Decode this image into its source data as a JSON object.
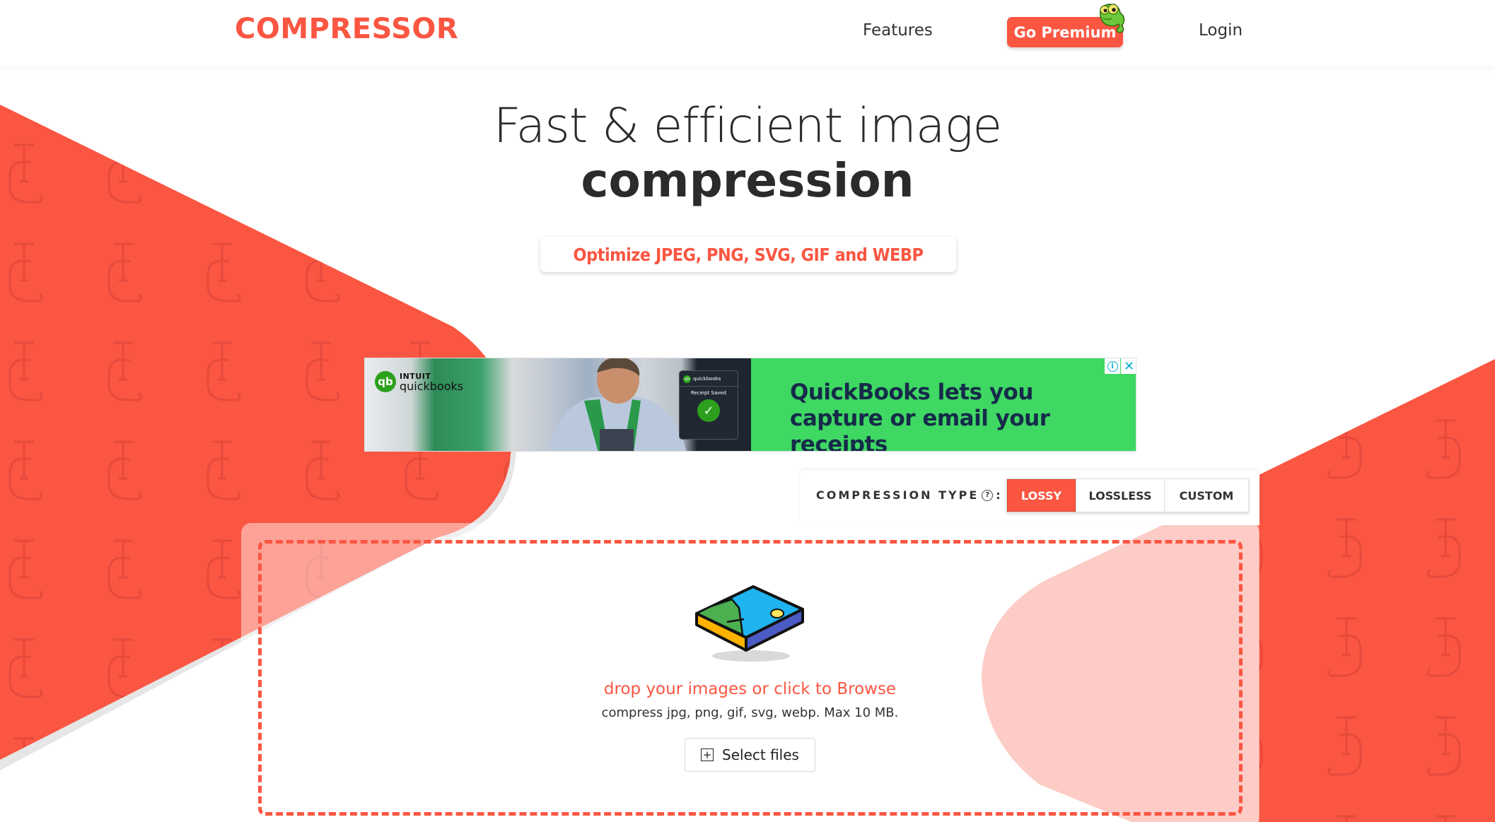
{
  "header": {
    "logo_text": "COMPRESSOR",
    "nav": {
      "features_label": "Features",
      "premium_label": "Go Premium",
      "login_label": "Login"
    }
  },
  "hero": {
    "title_line1": "Fast & efficient image",
    "title_line2": "compression",
    "tagline": "Optimize JPEG, PNG, SVG, GIF and WEBP"
  },
  "ad": {
    "brand_top": "INTUIT",
    "brand_bottom": "quickbooks",
    "brand_mark": "qb",
    "receipt_label": "Receipt Saved",
    "headline": "QuickBooks lets you capture or email your receipts",
    "info_icon": "info-icon",
    "close_icon": "close-icon"
  },
  "compression": {
    "label": "COMPRESSION TYPE",
    "suffix": ":",
    "options": [
      {
        "label": "LOSSY",
        "active": true
      },
      {
        "label": "LOSSLESS",
        "active": false
      },
      {
        "label": "CUSTOM",
        "active": false
      }
    ]
  },
  "dropzone": {
    "title": "drop your images or click to Browse",
    "subtitle": "compress jpg, png, gif, svg, webp. Max 10 MB.",
    "button_label": "Select files"
  },
  "colors": {
    "brand": "#fa5642",
    "ad_green": "#3ed863",
    "ad_text": "#162b4a",
    "text_dark": "#2b2b2b"
  }
}
